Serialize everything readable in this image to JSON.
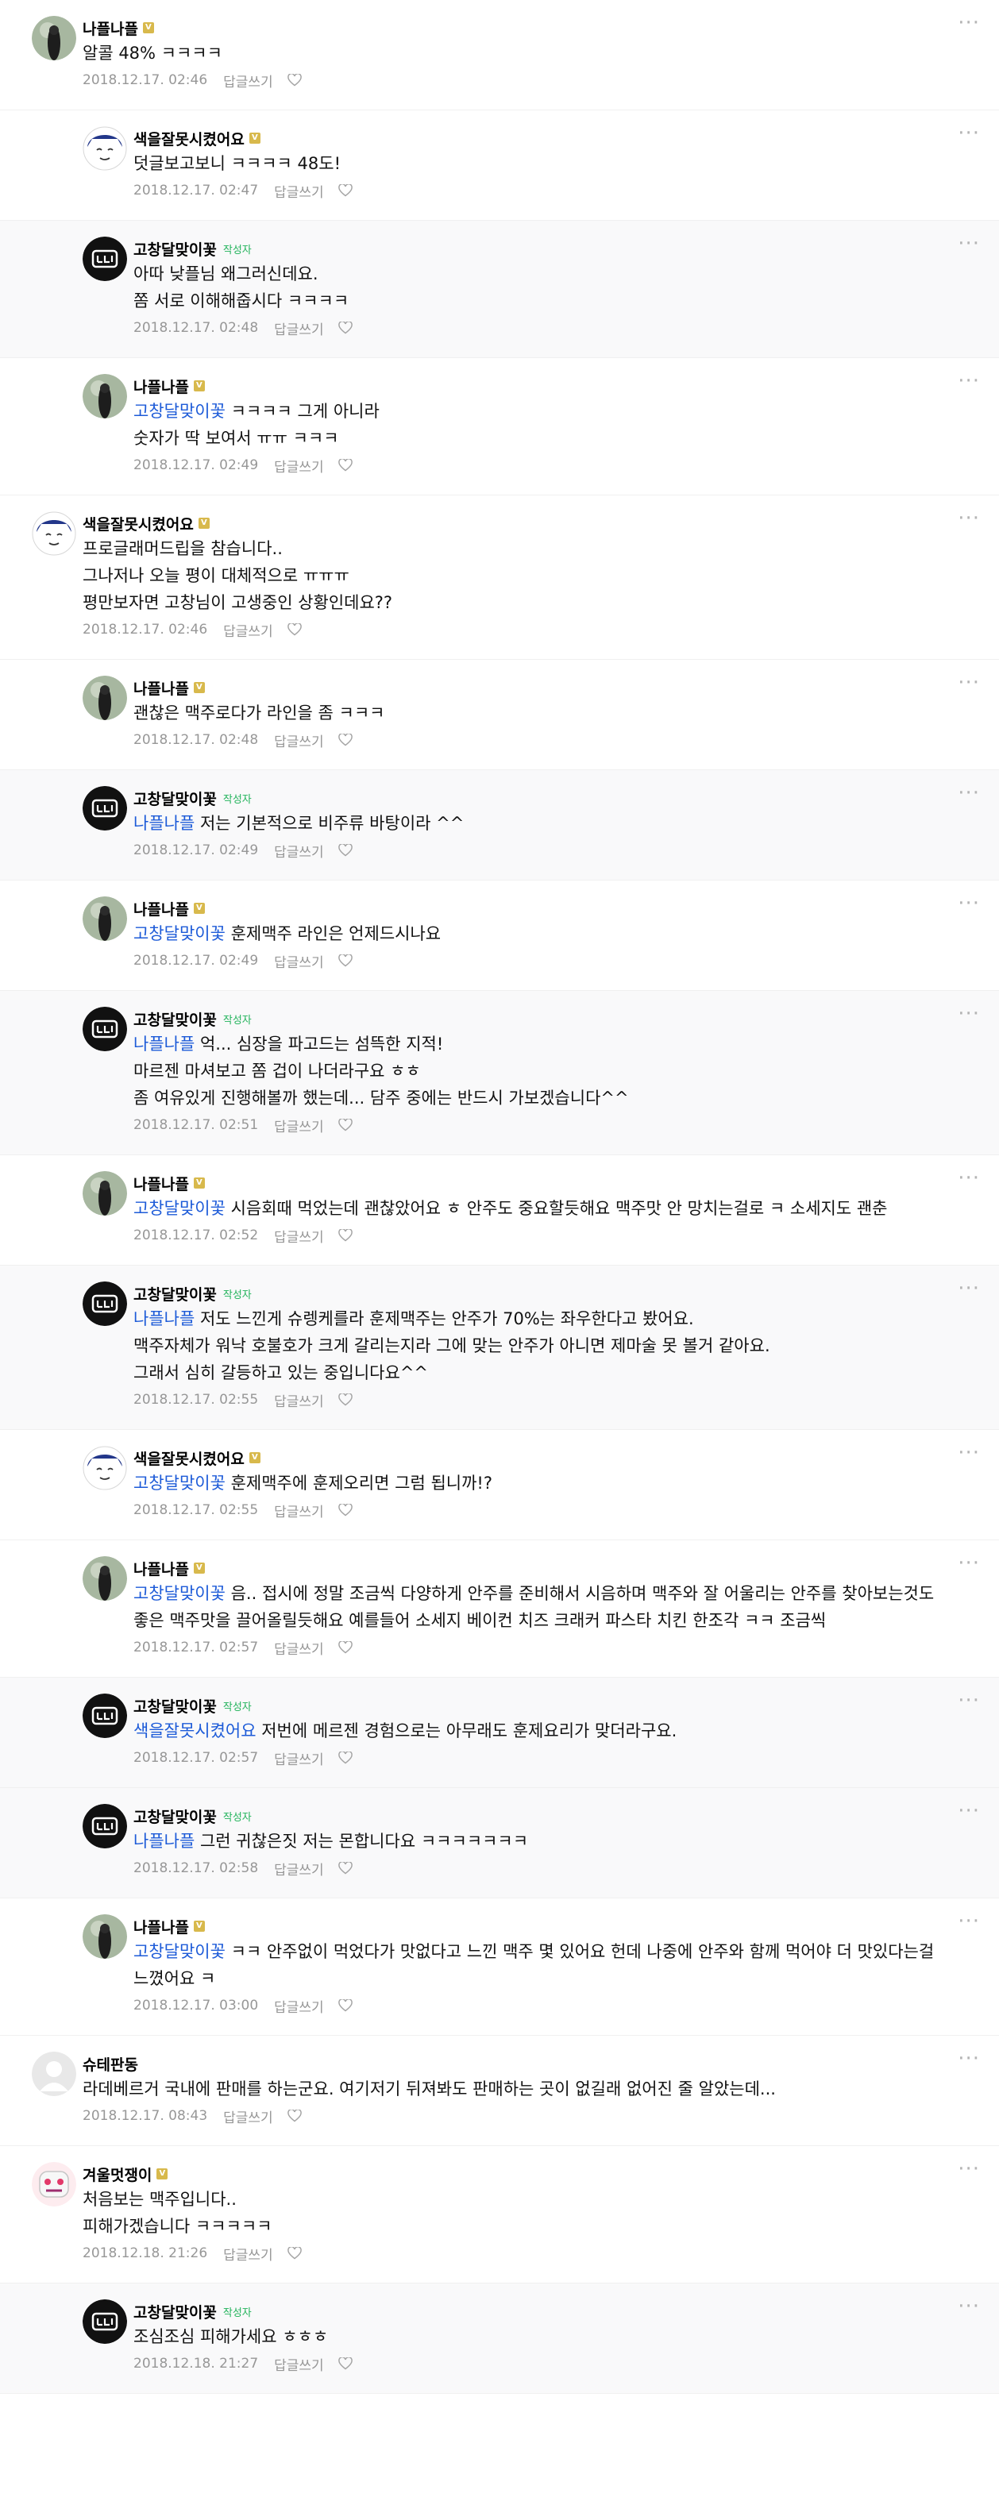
{
  "ui": {
    "reply_label": "답글쓰기",
    "author_tag": "작성자",
    "badge_symbol": "V",
    "more_symbol": "···",
    "accent_color": "#1d5bd8",
    "author_tag_color": "#22b35b"
  },
  "comments": [
    {
      "id": 0,
      "level": "top",
      "nick": "나플나플",
      "avatar": "nafl",
      "badge": true,
      "author": false,
      "mention": "",
      "text": "알콜 48% ㅋㅋㅋㅋ",
      "date": "2018.12.17. 02:46"
    },
    {
      "id": 1,
      "level": "reply",
      "nick": "색을잘못시켰어요",
      "avatar": "saek",
      "badge": true,
      "author": false,
      "mention": "",
      "text": "덧글보고보니 ㅋㅋㅋㅋ 48도!",
      "date": "2018.12.17. 02:47"
    },
    {
      "id": 2,
      "level": "reply",
      "nick": "고창달맞이꽃",
      "avatar": "gochang",
      "badge": false,
      "author": true,
      "mention": "",
      "text": "아따 낮플님 왜그러신데요.\n쫌 서로 이해해줍시다 ㅋㅋㅋㅋ",
      "date": "2018.12.17. 02:48"
    },
    {
      "id": 3,
      "level": "reply",
      "nick": "나플나플",
      "avatar": "nafl",
      "badge": true,
      "author": false,
      "mention": "고창달맞이꽃",
      "text": " ㅋㅋㅋㅋ 그게 아니라\n숫자가 딱 보여서 ㅠㅠ ㅋㅋㅋ",
      "date": "2018.12.17. 02:49"
    },
    {
      "id": 4,
      "level": "top",
      "nick": "색을잘못시켰어요",
      "avatar": "saek",
      "badge": true,
      "author": false,
      "mention": "",
      "text": "프로글래머드립을 참습니다..\n그나저나 오늘 평이 대체적으로 ㅠㅠㅠ\n평만보자면 고창님이 고생중인 상황인데요??",
      "date": "2018.12.17. 02:46"
    },
    {
      "id": 5,
      "level": "reply",
      "nick": "나플나플",
      "avatar": "nafl",
      "badge": true,
      "author": false,
      "mention": "",
      "text": "괜찮은 맥주로다가 라인을 좀 ㅋㅋㅋ",
      "date": "2018.12.17. 02:48"
    },
    {
      "id": 6,
      "level": "reply",
      "nick": "고창달맞이꽃",
      "avatar": "gochang",
      "badge": false,
      "author": true,
      "mention": "나플나플",
      "text": " 저는 기본적으로 비주류 바탕이라 ^^",
      "date": "2018.12.17. 02:49"
    },
    {
      "id": 7,
      "level": "reply",
      "nick": "나플나플",
      "avatar": "nafl",
      "badge": true,
      "author": false,
      "mention": "고창달맞이꽃",
      "text": " 훈제맥주 라인은 언제드시나요",
      "date": "2018.12.17. 02:49"
    },
    {
      "id": 8,
      "level": "reply",
      "nick": "고창달맞이꽃",
      "avatar": "gochang",
      "badge": false,
      "author": true,
      "mention": "나플나플",
      "text": " 억... 심장을 파고드는 섬뜩한 지적!\n마르젠 마셔보고 쫌 겁이 나더라구요 ㅎㅎ\n좀 여유있게 진행해볼까 했는데... 담주 중에는 반드시 가보겠습니다^^",
      "date": "2018.12.17. 02:51"
    },
    {
      "id": 9,
      "level": "reply",
      "nick": "나플나플",
      "avatar": "nafl",
      "badge": true,
      "author": false,
      "mention": "고창달맞이꽃",
      "text": " 시음회때 먹었는데 괜찮았어요 ㅎ 안주도 중요할듯해요 맥주맛 안 망치는걸로 ㅋ 소세지도 괜춘",
      "date": "2018.12.17. 02:52"
    },
    {
      "id": 10,
      "level": "reply",
      "nick": "고창달맞이꽃",
      "avatar": "gochang",
      "badge": false,
      "author": true,
      "mention": "나플나플",
      "text": " 저도 느낀게 슈렝케를라 훈제맥주는 안주가 70%는 좌우한다고 봤어요.\n맥주자체가 워낙 호불호가 크게 갈리는지라 그에 맞는 안주가 아니면 제마술 못 볼거 같아요.\n그래서 심히 갈등하고 있는 중입니다요^^",
      "date": "2018.12.17. 02:55"
    },
    {
      "id": 11,
      "level": "reply",
      "nick": "색을잘못시켰어요",
      "avatar": "saek",
      "badge": true,
      "author": false,
      "mention": "고창달맞이꽃",
      "text": " 훈제맥주에 훈제오리면 그럼 됩니까!?",
      "date": "2018.12.17. 02:55"
    },
    {
      "id": 12,
      "level": "reply",
      "nick": "나플나플",
      "avatar": "nafl",
      "badge": true,
      "author": false,
      "mention": "고창달맞이꽃",
      "text": " 음.. 접시에 정말 조금씩 다양하게 안주를 준비해서 시음하며 맥주와 잘 어울리는 안주를 찾아보는것도 좋은 맥주맛을 끌어올릴듯해요 예를들어 소세지 베이컨 치즈 크래커 파스타 치킨 한조각 ㅋㅋ 조금씩",
      "date": "2018.12.17. 02:57"
    },
    {
      "id": 13,
      "level": "reply",
      "nick": "고창달맞이꽃",
      "avatar": "gochang",
      "badge": false,
      "author": true,
      "mention": "색을잘못시켰어요",
      "text": " 저번에 메르젠 경험으로는 아무래도 훈제요리가 맞더라구요.",
      "date": "2018.12.17. 02:57"
    },
    {
      "id": 14,
      "level": "reply",
      "nick": "고창달맞이꽃",
      "avatar": "gochang",
      "badge": false,
      "author": true,
      "mention": "나플나플",
      "text": " 그런 귀찮은짓 저는 몬합니다요 ㅋㅋㅋㅋㅋㅋㅋ",
      "date": "2018.12.17. 02:58"
    },
    {
      "id": 15,
      "level": "reply",
      "nick": "나플나플",
      "avatar": "nafl",
      "badge": true,
      "author": false,
      "mention": "고창달맞이꽃",
      "text": " ㅋㅋ 안주없이 먹었다가 맛없다고 느낀 맥주 몇 있어요 헌데 나중에 안주와 함께 먹어야 더 맛있다는걸 느꼈어요 ㅋ",
      "date": "2018.12.17. 03:00"
    },
    {
      "id": 16,
      "level": "top",
      "nick": "슈테판동",
      "avatar": "default",
      "badge": false,
      "author": false,
      "mention": "",
      "text": "라데베르거 국내에 판매를 하는군요. 여기저기 뒤져봐도 판매하는 곳이 없길래 없어진 줄 알았는데...",
      "date": "2018.12.17. 08:43"
    },
    {
      "id": 17,
      "level": "top",
      "nick": "겨울멋쟁이",
      "avatar": "winter",
      "badge": true,
      "author": false,
      "mention": "",
      "text": "처음보는 맥주입니다..\n피해가겠습니다 ㅋㅋㅋㅋㅋ",
      "date": "2018.12.18. 21:26"
    },
    {
      "id": 18,
      "level": "reply",
      "nick": "고창달맞이꽃",
      "avatar": "gochang",
      "badge": false,
      "author": true,
      "mention": "",
      "text": "조심조심 피해가세요 ㅎㅎㅎ",
      "date": "2018.12.18. 21:27"
    }
  ]
}
